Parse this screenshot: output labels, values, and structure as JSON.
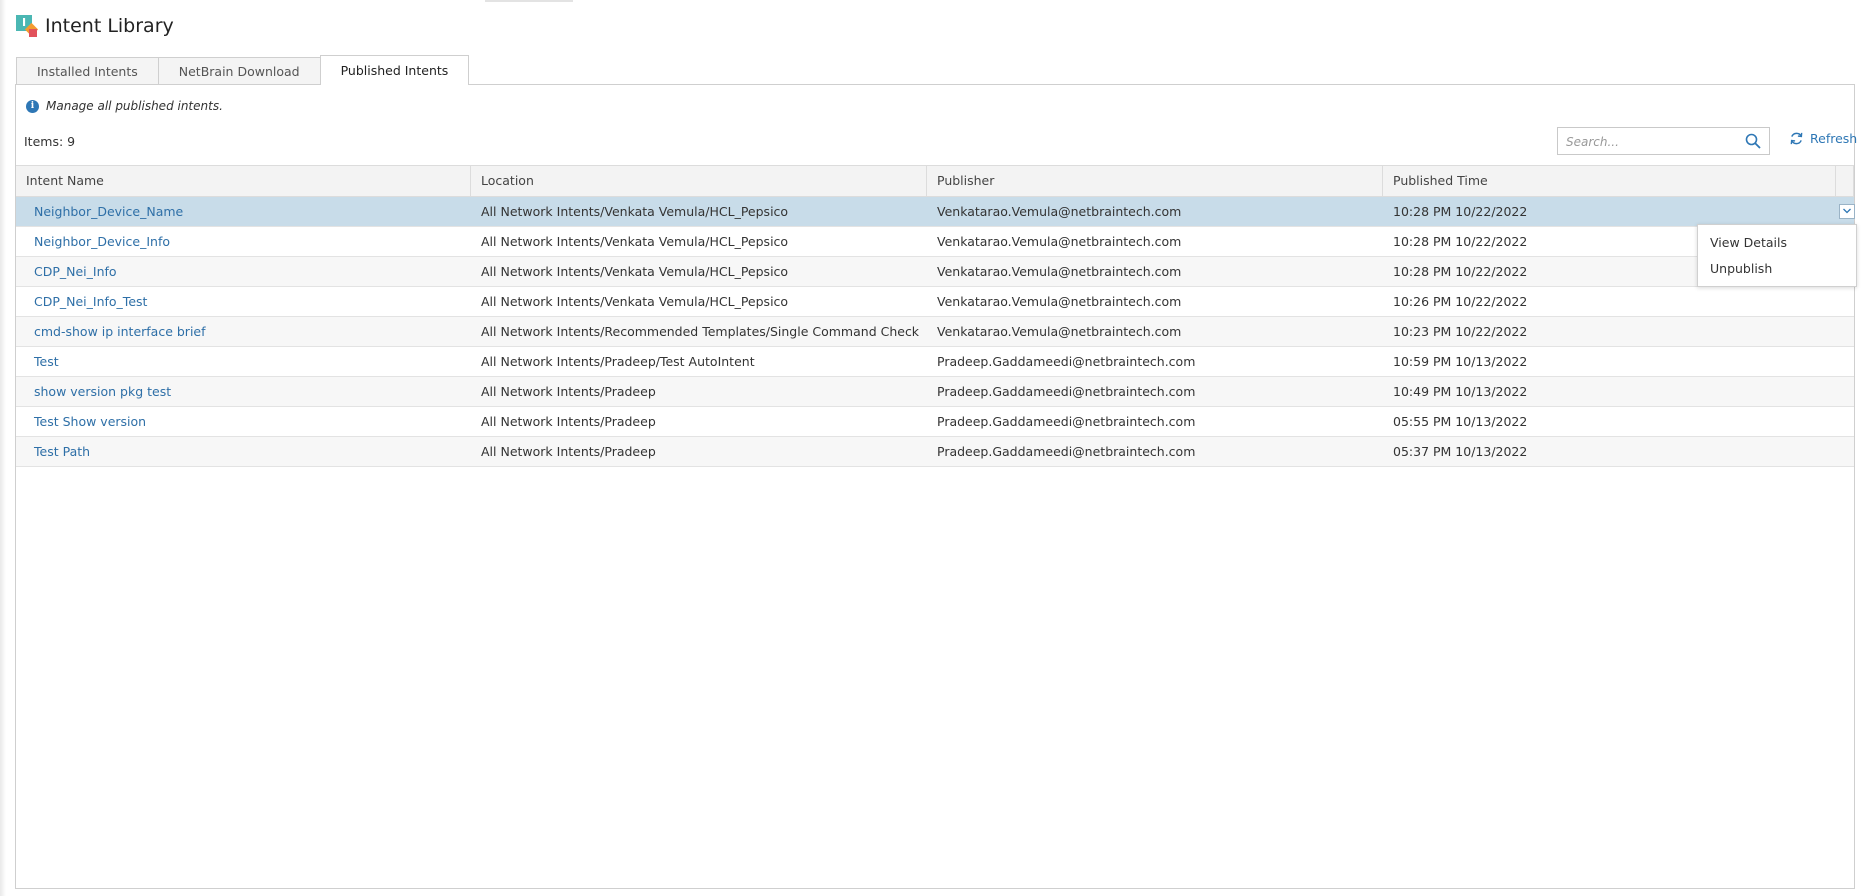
{
  "app": {
    "title": "Intent Library"
  },
  "tabs": [
    {
      "label": "Installed Intents"
    },
    {
      "label": "NetBrain Download"
    },
    {
      "label": "Published Intents"
    }
  ],
  "info": {
    "text": "Manage all published intents."
  },
  "items_count": "Items: 9",
  "search": {
    "placeholder": "Search...",
    "value": ""
  },
  "refresh_label": "Refresh",
  "columns": [
    "Intent Name",
    "Location",
    "Publisher",
    "Published Time"
  ],
  "rows": [
    {
      "name": "Neighbor_Device_Name",
      "location": "All Network Intents/Venkata Vemula/HCL_Pepsico",
      "publisher": "Venkatarao.Vemula@netbraintech.com",
      "time": "10:28 PM 10/22/2022"
    },
    {
      "name": "Neighbor_Device_Info",
      "location": "All Network Intents/Venkata Vemula/HCL_Pepsico",
      "publisher": "Venkatarao.Vemula@netbraintech.com",
      "time": "10:28 PM 10/22/2022"
    },
    {
      "name": "CDP_Nei_Info",
      "location": "All Network Intents/Venkata Vemula/HCL_Pepsico",
      "publisher": "Venkatarao.Vemula@netbraintech.com",
      "time": "10:28 PM 10/22/2022"
    },
    {
      "name": "CDP_Nei_Info_Test",
      "location": "All Network Intents/Venkata Vemula/HCL_Pepsico",
      "publisher": "Venkatarao.Vemula@netbraintech.com",
      "time": "10:26 PM 10/22/2022"
    },
    {
      "name": "cmd-show ip interface brief",
      "location": "All Network Intents/Recommended Templates/Single Command Check",
      "publisher": "Venkatarao.Vemula@netbraintech.com",
      "time": "10:23 PM 10/22/2022"
    },
    {
      "name": "Test",
      "location": "All Network Intents/Pradeep/Test AutoIntent",
      "publisher": "Pradeep.Gaddameedi@netbraintech.com",
      "time": "10:59 PM 10/13/2022"
    },
    {
      "name": "show version pkg test",
      "location": "All Network Intents/Pradeep",
      "publisher": "Pradeep.Gaddameedi@netbraintech.com",
      "time": "10:49 PM 10/13/2022"
    },
    {
      "name": "Test Show version",
      "location": "All Network Intents/Pradeep",
      "publisher": "Pradeep.Gaddameedi@netbraintech.com",
      "time": "05:55 PM 10/13/2022"
    },
    {
      "name": "Test Path",
      "location": "All Network Intents/Pradeep",
      "publisher": "Pradeep.Gaddameedi@netbraintech.com",
      "time": "05:37 PM 10/13/2022"
    }
  ],
  "context_menu": {
    "items": [
      "View Details",
      "Unpublish"
    ]
  },
  "colors": {
    "accent": "#2e77b5",
    "link": "#2e6fa7",
    "selected_row": "#c8dce9"
  }
}
